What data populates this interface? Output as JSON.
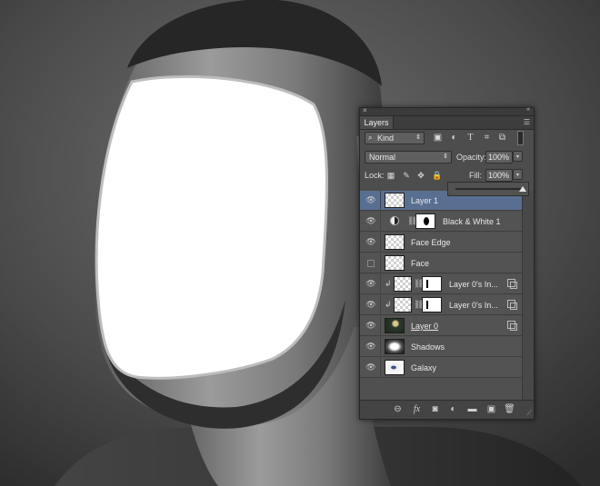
{
  "panel": {
    "close_glyph": "×",
    "collapse_glyph": "«",
    "tab_label": "Layers",
    "menu_glyph": "☰",
    "filter": {
      "icon": "search-icon",
      "label": "Kind",
      "arrow": "⇕"
    },
    "filter_icons": [
      "image-filter-icon",
      "adjustment-filter-icon",
      "type-filter-icon",
      "shape-filter-icon",
      "smart-object-filter-icon"
    ],
    "blend_mode": {
      "value": "Normal",
      "arrow": "⇕"
    },
    "opacity": {
      "label": "Opacity:",
      "value": "100%",
      "arrow": "▾"
    },
    "lock": {
      "label": "Lock:",
      "icons": [
        "lock-pixels-icon",
        "brush-icon",
        "move-icon",
        "lock-icon"
      ]
    },
    "fill": {
      "label": "Fill:",
      "value": "100%",
      "arrow": "▾"
    },
    "fill_slider_value": 1.0,
    "layers": [
      {
        "name": "Layer 1",
        "selected": true,
        "visible": true,
        "thumb": "transparent"
      },
      {
        "name": "Black & White 1",
        "selected": false,
        "visible": true,
        "thumb": "adjustment",
        "mask": "face"
      },
      {
        "name": "Face Edge",
        "selected": false,
        "visible": true,
        "thumb": "transparent"
      },
      {
        "name": "Face",
        "selected": false,
        "visible": false,
        "thumb": "transparent"
      },
      {
        "name": "Layer 0's In...",
        "selected": false,
        "visible": true,
        "clipped": true,
        "thumb": "transparent",
        "mask": "bar",
        "smart": true
      },
      {
        "name": "Layer 0's In...",
        "selected": false,
        "visible": true,
        "clipped": true,
        "thumb": "transparent",
        "mask": "bar",
        "smart": true
      },
      {
        "name": "Layer 0",
        "selected": false,
        "visible": true,
        "thumb": "photo",
        "underline": true,
        "smart": true
      },
      {
        "name": "Shadows",
        "selected": false,
        "visible": true,
        "thumb": "shadows"
      },
      {
        "name": "Galaxy",
        "selected": false,
        "visible": true,
        "thumb": "galaxy"
      }
    ],
    "bottom_icons": [
      "link-layers-icon",
      "fx-icon",
      "add-mask-icon",
      "new-adjustment-icon",
      "new-group-icon",
      "new-layer-icon",
      "trash-icon"
    ],
    "bottom_glyphs": [
      "⊖",
      "fx",
      "◙",
      "◐",
      "▬",
      "▣",
      "🗑"
    ]
  }
}
